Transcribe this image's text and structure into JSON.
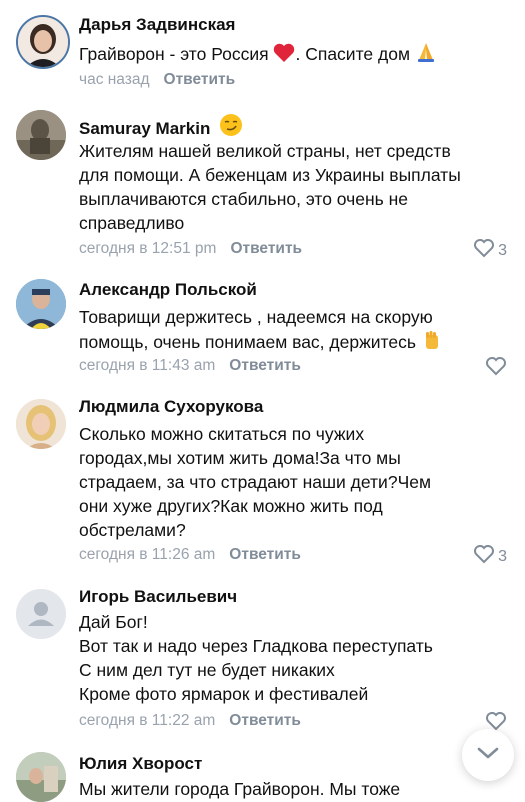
{
  "comments": [
    {
      "author": "Дарья Задвинская",
      "lines": [
        "Грайворон - это Россия",
        ". Спасите дом"
      ],
      "time": "час назад",
      "reply": "Ответить",
      "likes": ""
    },
    {
      "author": "Samuray Markin",
      "lines": [
        "Жителям нашей великой страны, нет средств",
        "для помощи. А беженцам из Украины выплаты",
        "выплачиваются стабильно, это очень не",
        "справедливо"
      ],
      "time": "сегодня в 12:51 pm",
      "reply": "Ответить",
      "likes": "3"
    },
    {
      "author": "Александр Польской",
      "lines": [
        "Товарищи держитесь , надеемся на скорую",
        "помощь, очень понимаем вас, держитесь"
      ],
      "time": "сегодня в 11:43 am",
      "reply": "Ответить",
      "likes": ""
    },
    {
      "author": "Людмила Сухорукова",
      "lines": [
        "Сколько можно скитаться по  чужих",
        "городах,мы хотим жить дома!За что мы",
        "страдаем, за что страдают наши дети?Чем",
        "они хуже других?Как можно жить под",
        "обстрелами?"
      ],
      "time": "сегодня в 11:26 am",
      "reply": "Ответить",
      "likes": "3"
    },
    {
      "author": "Игорь Васильевич",
      "lines": [
        "Дай Бог!",
        "Вот так и надо через Гладкова переступать",
        "С ним дел тут не будет никаких",
        "Кроме фото ярмарок и фестивалей"
      ],
      "time": "сегодня в 11:22 am",
      "reply": "Ответить",
      "likes": ""
    },
    {
      "author": "Юлия Хворост",
      "lines": [
        "Мы жители города Грайворон. Мы тоже"
      ],
      "time": "",
      "reply": "",
      "likes": ""
    }
  ],
  "icons": {
    "heart_emoji": "heart-emoji-icon",
    "pray_emoji": "folded-hands-emoji-icon",
    "smirk_emoji": "smirking-face-emoji-icon",
    "fist_emoji": "raised-fist-emoji-icon",
    "like": "heart-outline-icon",
    "scroll_down": "chevron-down-icon"
  },
  "colors": {
    "meta_text": "#99a2ad",
    "reply_text": "#818c99",
    "heart_red": "#e0243a"
  }
}
